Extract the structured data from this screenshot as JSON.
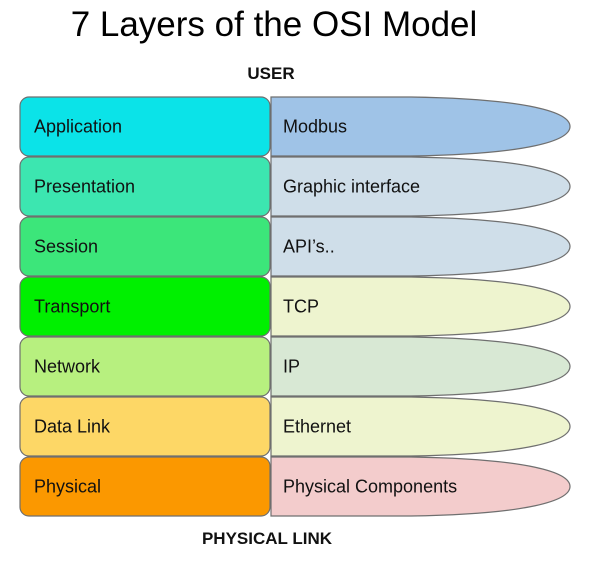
{
  "title": "7 Layers of the OSI Model",
  "top_label": "USER",
  "bottom_label": "PHYSICAL LINK",
  "layers": [
    {
      "name": "Application",
      "color": "#0be3e8",
      "protocol": "Modbus",
      "protocol_color": "#9fc3e7"
    },
    {
      "name": "Presentation",
      "color": "#3ce6b0",
      "protocol": "Graphic interface",
      "protocol_color": "#cfdee9"
    },
    {
      "name": "Session",
      "color": "#3ce67a",
      "protocol": "API’s..",
      "protocol_color": "#cfdee9"
    },
    {
      "name": "Transport",
      "color": "#00f000",
      "protocol": "TCP",
      "protocol_color": "#eef4cf"
    },
    {
      "name": "Network",
      "color": "#b7f07f",
      "protocol": "IP",
      "protocol_color": "#d8e8d4"
    },
    {
      "name": "Data Link",
      "color": "#fdd766",
      "protocol": "Ethernet",
      "protocol_color": "#eef4cf"
    },
    {
      "name": "Physical",
      "color": "#fb9800",
      "protocol": "Physical Components",
      "protocol_color": "#f3cccc"
    }
  ]
}
